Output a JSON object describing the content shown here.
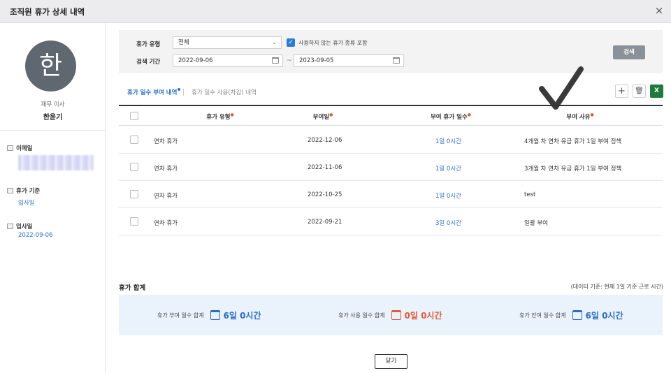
{
  "window": {
    "title": "조직원 휴가 상세 내역",
    "close_icon": "×"
  },
  "profile": {
    "avatar_char": "한",
    "role": "재무 이사",
    "name": "한윤기",
    "email_label": "이메일",
    "vacation_basis_label": "휴가 기준",
    "vacation_basis_value": "입사일",
    "hire_date_label": "입사일",
    "hire_date_value": "2022-09-06"
  },
  "filter": {
    "type_label": "휴가 유형",
    "type_value": "전체",
    "include_unused_label": "사용하지 않는 휴가 종류 포함",
    "include_unused_checked": true,
    "period_label": "검색 기간",
    "start_date": "2022-09-06",
    "end_date": "2023-09-05",
    "range_sep": "~",
    "search_button": "검색"
  },
  "tabs": [
    {
      "label": "휴가 일수 부여 내역",
      "active": true
    },
    {
      "label": "휴가 일수 사용(차감) 내역",
      "active": false
    }
  ],
  "toolbar": {
    "add_icon": "+",
    "delete_icon": "🗑",
    "excel_icon": "X"
  },
  "table": {
    "headers": [
      "휴가 유형",
      "부여일",
      "부여 휴가 일수",
      "부여 사유"
    ],
    "rows": [
      {
        "type": "연차 휴가",
        "date": "2022-12-06",
        "days": "1일 0시간",
        "reason": "4개월 차 연차 유급 휴가 1일 부여 정책"
      },
      {
        "type": "연차 휴가",
        "date": "2022-11-06",
        "days": "1일 0시간",
        "reason": "3개월 차 연차 유급 휴가 1일 부여 정책"
      },
      {
        "type": "연차 휴가",
        "date": "2022-10-25",
        "days": "1일 0시간",
        "reason": "test"
      },
      {
        "type": "연차 휴가",
        "date": "2022-09-21",
        "days": "3일 0시간",
        "reason": "일괄 부여"
      }
    ]
  },
  "summary": {
    "title": "휴가 합계",
    "note": "(데이터 기준: 현재 1일 기준 근로 시간)",
    "granted_label": "휴가 부여 일수 합계",
    "granted_value": "6일 0시간",
    "used_label": "휴가 사용 일수 합계",
    "used_value": "0일 0시간",
    "remaining_label": "휴가 잔여 일수 합계",
    "remaining_value": "6일 0시간"
  },
  "footer": {
    "close_button": "닫기"
  },
  "colors": {
    "accent": "#2c6fc5",
    "warning": "#e25b3c",
    "excel": "#1f7a3d"
  }
}
